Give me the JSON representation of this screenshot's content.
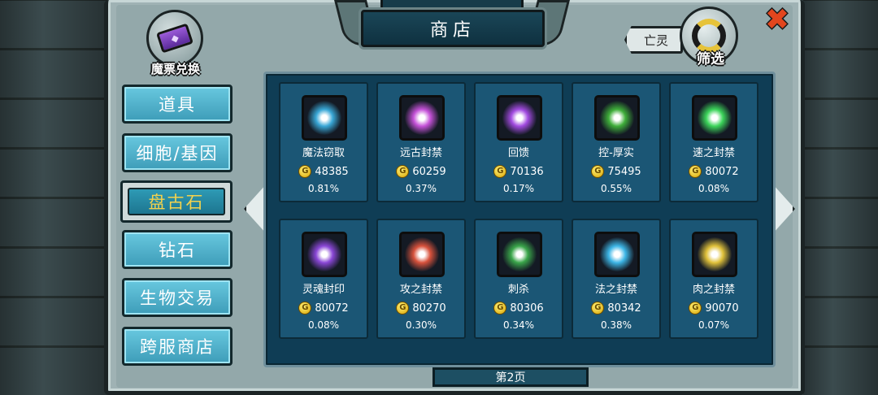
{
  "header": {
    "title": "商店",
    "coupon_label": "魔票兑换",
    "coupon_icon": "ticket-icon",
    "close_icon": "close-icon",
    "faction_tag": "亡灵",
    "filter_label": "筛选",
    "filter_icon": "refresh-icon"
  },
  "categories": [
    {
      "label": "道具",
      "active": false
    },
    {
      "label": "细胞/基因",
      "active": false
    },
    {
      "label": "盘古石",
      "active": true
    },
    {
      "label": "钻石",
      "active": false
    },
    {
      "label": "生物交易",
      "active": false
    },
    {
      "label": "跨服商店",
      "active": false
    }
  ],
  "items": [
    {
      "name": "魔法窃取",
      "price": "48385",
      "rate": "0.81%",
      "color": "#39a7d6"
    },
    {
      "name": "远古封禁",
      "price": "60259",
      "rate": "0.37%",
      "color": "#c552d8"
    },
    {
      "name": "回馈",
      "price": "70136",
      "rate": "0.17%",
      "color": "#a24be0"
    },
    {
      "name": "控-厚实",
      "price": "75495",
      "rate": "0.55%",
      "color": "#3fae3a"
    },
    {
      "name": "速之封禁",
      "price": "80072",
      "rate": "0.08%",
      "color": "#3cd45a"
    },
    {
      "name": "灵魂封印",
      "price": "80072",
      "rate": "0.08%",
      "color": "#8a47d6"
    },
    {
      "name": "攻之封禁",
      "price": "80270",
      "rate": "0.30%",
      "color": "#d8523c"
    },
    {
      "name": "刺杀",
      "price": "80306",
      "rate": "0.34%",
      "color": "#3aa54a"
    },
    {
      "name": "法之封禁",
      "price": "80342",
      "rate": "0.38%",
      "color": "#3db6e6"
    },
    {
      "name": "肉之封禁",
      "price": "90070",
      "rate": "0.07%",
      "color": "#e0c13a"
    }
  ],
  "coin_symbol": "G",
  "coin_icon": "gold-coin-icon",
  "pagination": {
    "label": "第2页"
  }
}
